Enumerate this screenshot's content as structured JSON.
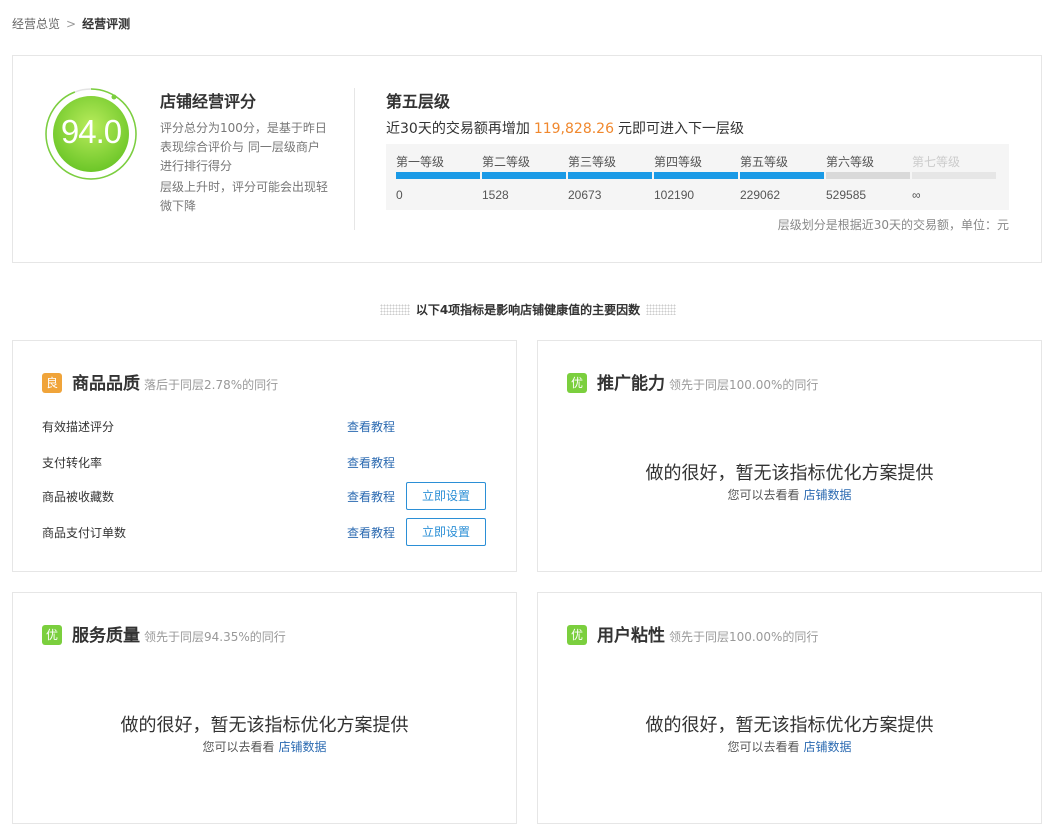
{
  "breadcrumb": {
    "parent": "经营总览",
    "separator": ">",
    "current": "经营评测"
  },
  "score": {
    "value": "94.0",
    "ring_fraction": 0.94,
    "title": "店铺经营评分",
    "desc1": "评分总分为100分，是基于昨日表现综合评价与 同一层级商户进行排行得分",
    "desc2": "层级上升时，评分可能会出现轻微下降"
  },
  "level": {
    "title": "第五层级",
    "line_prefix": "近30天的交易额再增加",
    "amount": "119,828.26",
    "line_suffix": "元即可进入下一层级",
    "tiers": [
      {
        "name": "第一等级",
        "value": "0",
        "active": true
      },
      {
        "name": "第二等级",
        "value": "1528",
        "active": true
      },
      {
        "name": "第三等级",
        "value": "20673",
        "active": true
      },
      {
        "name": "第四等级",
        "value": "102190",
        "active": true
      },
      {
        "name": "第五等级",
        "value": "229062",
        "active": true
      },
      {
        "name": "第六等级",
        "value": "529585",
        "active": false
      },
      {
        "name": "第七等级",
        "value": "∞",
        "active": false
      }
    ],
    "note": "层级划分是根据近30天的交易额，单位：元"
  },
  "section_title": "以下4项指标是影响店铺健康值的主要因数",
  "panels": {
    "quality": {
      "badge": "良",
      "title": "商品品质",
      "sub": "落后于同层2.78%的同行",
      "metrics": [
        {
          "name": "有效描述评分",
          "link": "查看教程"
        },
        {
          "name": "支付转化率",
          "link": "查看教程"
        },
        {
          "name": "商品被收藏数",
          "link": "查看教程",
          "button": "立即设置"
        },
        {
          "name": "商品支付订单数",
          "link": "查看教程",
          "button": "立即设置"
        }
      ]
    },
    "promotion": {
      "badge": "优",
      "title": "推广能力",
      "sub": "领先于同层100.00%的同行",
      "msg": "做的很好，暂无该指标优化方案提供",
      "tip": "您可以去看看",
      "tip_link": "店铺数据"
    },
    "service": {
      "badge": "优",
      "title": "服务质量",
      "sub": "领先于同层94.35%的同行",
      "msg": "做的很好，暂无该指标优化方案提供",
      "tip": "您可以去看看",
      "tip_link": "店铺数据"
    },
    "stickiness": {
      "badge": "优",
      "title": "用户粘性",
      "sub": "领先于同层100.00%的同行",
      "msg": "做的很好，暂无该指标优化方案提供",
      "tip": "您可以去看看",
      "tip_link": "店铺数据"
    }
  },
  "colors": {
    "accent_blue": "#1a9ae6",
    "link_blue": "#2b6ab1",
    "orange": "#f0882e",
    "green": "#7bcf3e",
    "badge_good": "#f0a43a"
  }
}
